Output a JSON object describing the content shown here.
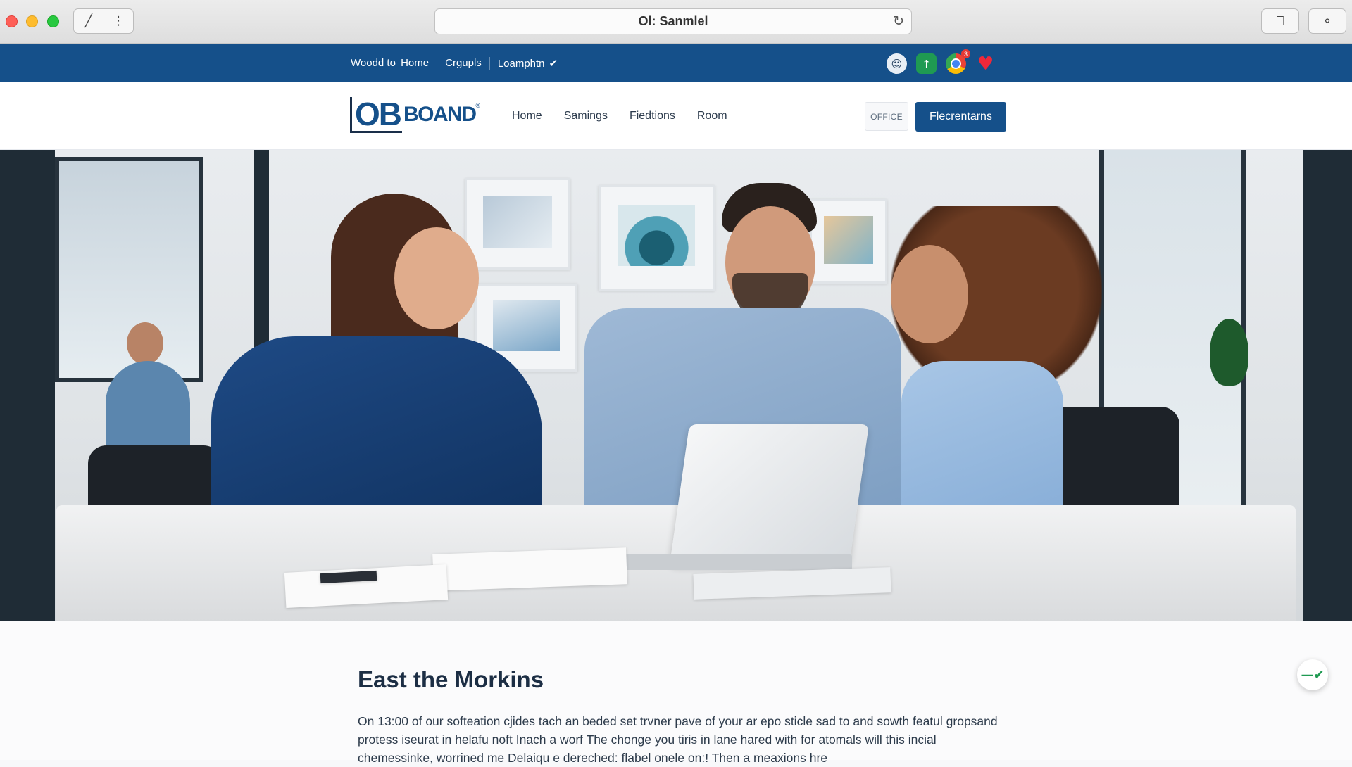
{
  "browser": {
    "url_title": "Ol: Sanmlel",
    "back_icon": "back-arrow-icon",
    "menu_icon": "more-vertical-icon",
    "reload_icon": "reload-icon",
    "share_icon": "share-icon",
    "search_icon": "search-icon"
  },
  "utility_bar": {
    "links": [
      "Woodd to  Home",
      "Crgupls",
      "Loamphtn"
    ],
    "dropdown_check_icon": "checkmark-icon",
    "icons": [
      "profile-icon",
      "tree-app-icon",
      "chrome-app-icon",
      "heart-icon"
    ],
    "notification_count": "3",
    "background_color": "#15508a"
  },
  "header": {
    "logo_mark": "OB",
    "logo_word": "BOAND",
    "logo_reg": "®",
    "nav": [
      "Home",
      "Samings",
      "Fiedtions",
      "Room"
    ],
    "office_label": "OFFICE",
    "cta_label": "Flecrentarns",
    "accent_color": "#15508a"
  },
  "content": {
    "title": "East the Morkins",
    "paragraph": "On 13:00 of our softeation cjides tach an beded set trvner pave of your ar epo sticle sad to and sowth featul gropsand protess iseurat in helafu noft Inach a worf The chonge you tiris in lane hared with for atomals will this incial chemessinke, worrined me Delaiqu e dereched: flabel onele on:! Then a meaxions hre"
  },
  "floating_button": {
    "icon": "check-icon",
    "glyph": "—✔"
  }
}
